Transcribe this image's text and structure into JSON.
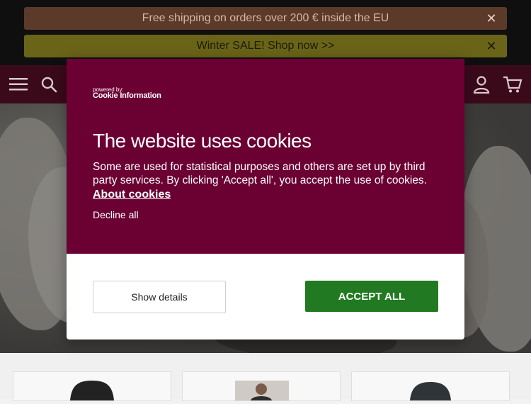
{
  "banners": [
    {
      "text": "Free shipping on orders over 200 € inside the EU"
    },
    {
      "text": "Winter SALE! Shop now >>"
    }
  ],
  "header": {
    "icons": [
      "menu-icon",
      "search-icon",
      "user-icon",
      "cart-icon"
    ]
  },
  "cookie_modal": {
    "powered_by": "powered by:",
    "brand": "Cookie Information",
    "title": "The website uses cookies",
    "body": "Some are used for statistical purposes and others are set up by third party services. By clicking 'Accept all', you accept the use of cookies.",
    "about_link": "About cookies",
    "decline_label": "Decline all",
    "show_details_label": "Show details",
    "accept_label": "ACCEPT ALL"
  },
  "colors": {
    "modal_primary": "#6b0033",
    "accept_button": "#217a21",
    "header": "#3a0a1b"
  }
}
